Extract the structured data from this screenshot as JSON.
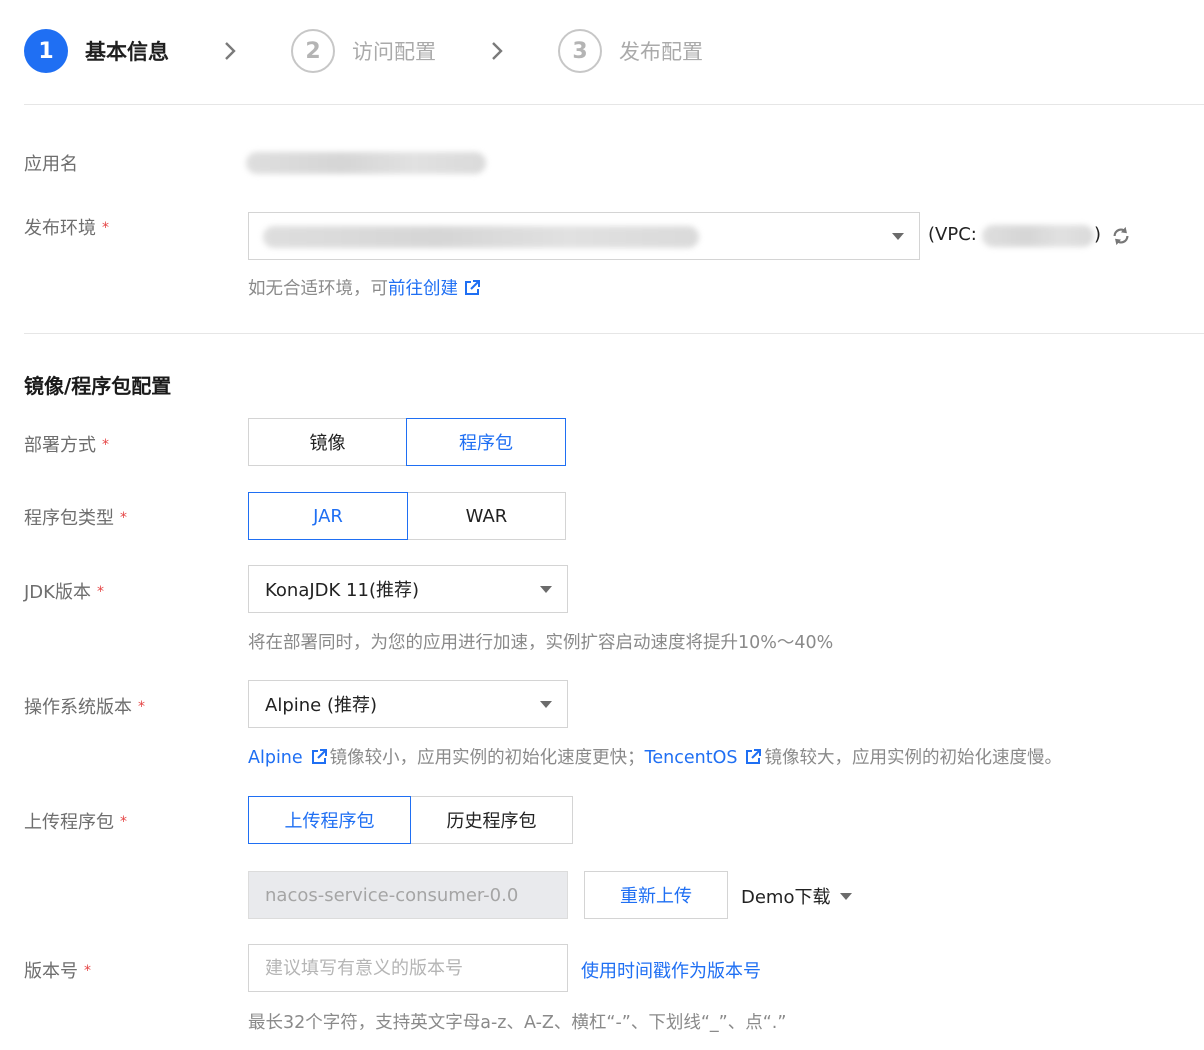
{
  "steps": [
    {
      "number": "1",
      "label": "基本信息"
    },
    {
      "number": "2",
      "label": "访问配置"
    },
    {
      "number": "3",
      "label": "发布配置"
    }
  ],
  "form": {
    "app_name_label": "应用名",
    "env_label": "发布环境",
    "vpc_prefix": "(VPC:",
    "vpc_suffix": ")",
    "env_hint_prefix": "如无合适环境，可",
    "env_hint_link": "前往创建",
    "required_mark": "*"
  },
  "section": {
    "title": "镜像/程序包配置"
  },
  "deploy_mode": {
    "label": "部署方式",
    "options": [
      "镜像",
      "程序包"
    ],
    "selected": "程序包"
  },
  "package_type": {
    "label": "程序包类型",
    "options": [
      "JAR",
      "WAR"
    ],
    "selected": "JAR"
  },
  "jdk": {
    "label": "JDK版本",
    "value": "KonaJDK 11(推荐)",
    "hint": "将在部署同时，为您的应用进行加速，实例扩容启动速度将提升10%～40%"
  },
  "os": {
    "label": "操作系统版本",
    "value": "Alpine (推荐)",
    "hint_link1": "Alpine",
    "hint_text1": "镜像较小，应用实例的初始化速度更快；",
    "hint_link2": "TencentOS",
    "hint_text2": "镜像较大，应用实例的初始化速度慢。"
  },
  "upload": {
    "label": "上传程序包",
    "options": [
      "上传程序包",
      "历史程序包"
    ],
    "selected": "上传程序包",
    "file_value": "nacos-service-consumer-0.0",
    "reupload_label": "重新上传",
    "demo_label": "Demo下载"
  },
  "version": {
    "label": "版本号",
    "placeholder": "建议填写有意义的版本号",
    "timestamp_link": "使用时间戳作为版本号",
    "hint": "最长32个字符，支持英文字母a-z、A-Z、横杠“-”、下划线“_”、点“.”"
  },
  "colors": {
    "accent": "#1f6ff3",
    "required": "#e54545"
  }
}
